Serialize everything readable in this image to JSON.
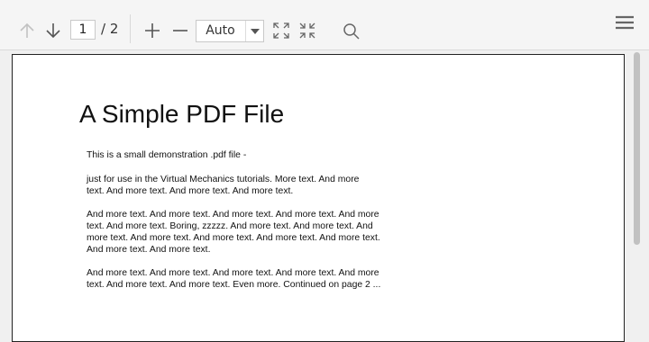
{
  "toolbar": {
    "page_current": "1",
    "page_count": "/ 2",
    "zoom_value": "Auto",
    "icons": [
      "arrow-up-icon",
      "arrow-down-icon",
      "plus-icon",
      "minus-icon",
      "chevron-down-icon",
      "expand-icon",
      "compress-icon",
      "search-icon",
      "menu-icon"
    ]
  },
  "document": {
    "title": "A Simple PDF File",
    "paragraphs": [
      "This is a small demonstration .pdf file -",
      "just for use in the Virtual Mechanics tutorials. More text. And more\ntext. And more text. And more text. And more text.",
      "And more text. And more text. And more text. And more text. And more\ntext. And more text. Boring, zzzzz. And more text. And more text. And\nmore text. And more text. And more text. And more text. And more text.\nAnd more text. And more text.",
      "And more text. And more text. And more text. And more text. And more\ntext. And more text. And more text. Even more. Continued on page 2 ..."
    ]
  }
}
